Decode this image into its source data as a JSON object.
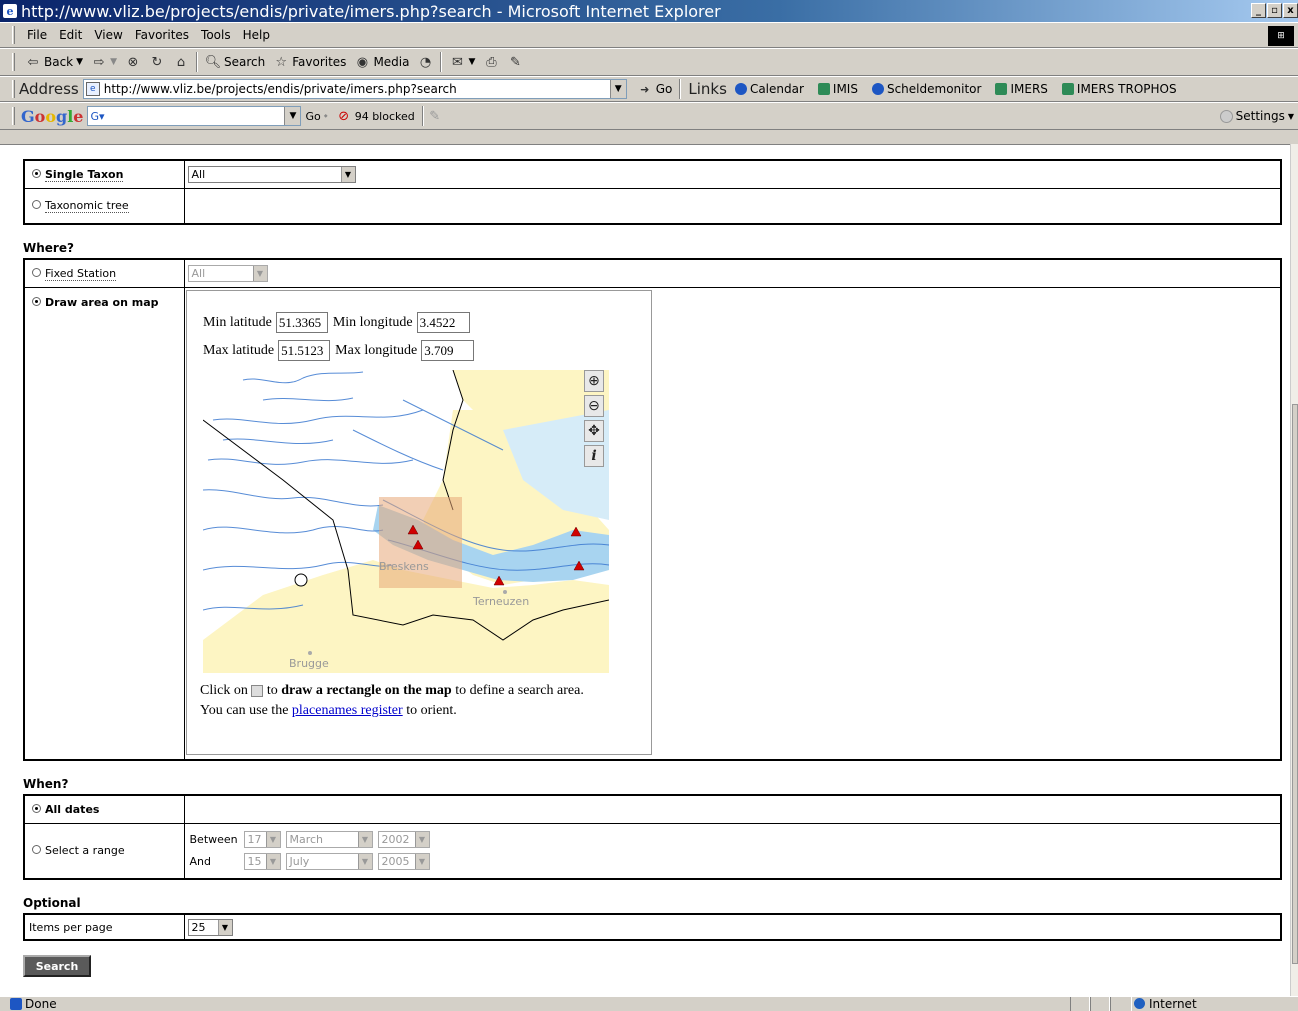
{
  "window": {
    "title": "http://www.vliz.be/projects/endis/private/imers.php?search - Microsoft Internet Explorer",
    "btn_min": "_",
    "btn_max": "▫",
    "btn_close": "x"
  },
  "menu": [
    "File",
    "Edit",
    "View",
    "Favorites",
    "Tools",
    "Help"
  ],
  "toolbar": {
    "back": "Back",
    "search": "Search",
    "favorites": "Favorites",
    "media": "Media"
  },
  "address": {
    "label": "Address",
    "url": "http://www.vliz.be/projects/endis/private/imers.php?search",
    "go": "Go",
    "links_label": "Links",
    "links": [
      "Calendar",
      "IMIS",
      "Scheldemonitor",
      "IMERS",
      "IMERS TROPHOS"
    ]
  },
  "google": {
    "logo": "Google",
    "go": "Go",
    "blocked": "94 blocked",
    "settings": "Settings"
  },
  "taxon": {
    "single_label": "Single Taxon",
    "single_value": "All",
    "tree_label": "Taxonomic tree"
  },
  "where": {
    "heading": "Where?",
    "fixed_label": "Fixed Station",
    "fixed_value": "All",
    "draw_label": "Draw area on map",
    "min_lat_label": "Min latitude",
    "min_lat": "51.3365",
    "min_lon_label": "Min longitude",
    "min_lon": "3.4522",
    "max_lat_label": "Max latitude",
    "max_lat": "51.5123",
    "max_lon_label": "Max longitude",
    "max_lon": "3.709",
    "places": [
      "Breskens",
      "Terneuzen",
      "Brugge"
    ],
    "help_pre": "Click on",
    "help_mid": "to",
    "help_bold": "draw a rectangle on the map",
    "help_post": "to define a search area.",
    "help2_pre": "You can use the",
    "help2_link": "placenames register",
    "help2_post": "to orient."
  },
  "when": {
    "heading": "When?",
    "all_label": "All dates",
    "range_label": "Select a range",
    "between": "Between",
    "and": "And",
    "from_day": "17",
    "from_month": "March",
    "from_year": "2002",
    "to_day": "15",
    "to_month": "July",
    "to_year": "2005"
  },
  "optional": {
    "heading": "Optional",
    "items_label": "Items per page",
    "items_value": "25"
  },
  "search_button": "Search",
  "status": {
    "done": "Done",
    "zone": "Internet"
  }
}
